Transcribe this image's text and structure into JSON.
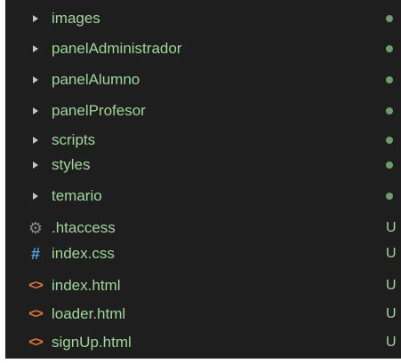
{
  "folders": [
    {
      "name": "images"
    },
    {
      "name": "panelAdministrador"
    },
    {
      "name": "panelAlumno"
    },
    {
      "name": "panelProfesor"
    },
    {
      "name": "scripts"
    },
    {
      "name": "styles"
    },
    {
      "name": "temario"
    }
  ],
  "files": [
    {
      "name": ".htaccess",
      "icon": "gear-icon",
      "glyph": "⚙",
      "status": "U"
    },
    {
      "name": "index.css",
      "icon": "hash-icon",
      "glyph": "#",
      "status": "U"
    },
    {
      "name": "index.html",
      "icon": "html-icon",
      "glyph": "<>",
      "status": "U"
    },
    {
      "name": "loader.html",
      "icon": "html-icon",
      "glyph": "<>",
      "status": "U"
    },
    {
      "name": "signUp.html",
      "icon": "html-icon",
      "glyph": "<>",
      "status": "U"
    }
  ],
  "colors": {
    "background": "#1e1e1e",
    "untracked_text": "#9fd69b",
    "modified_dot": "#6c9e69",
    "css_icon": "#4fa0d8",
    "html_icon": "#e37933"
  }
}
